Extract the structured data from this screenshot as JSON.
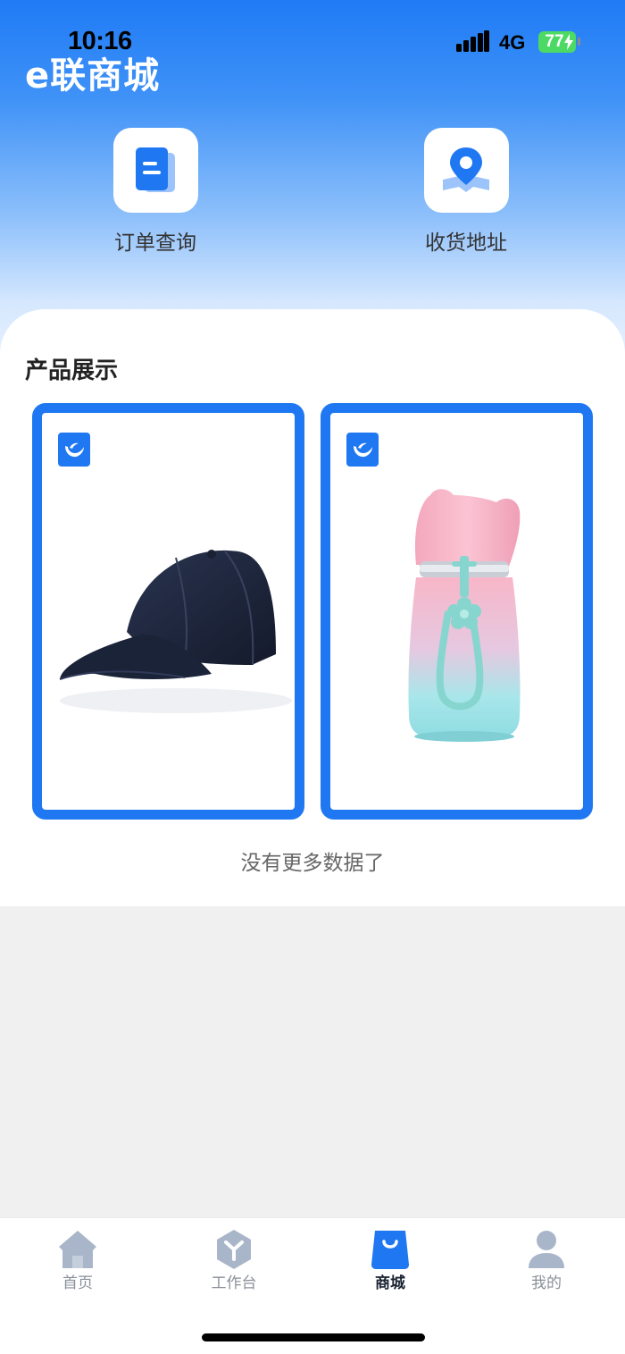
{
  "status_bar": {
    "time": "10:16",
    "network": "4G",
    "battery": "77"
  },
  "app": {
    "title": "e联商城"
  },
  "quick_entries": [
    {
      "label": "订单查询",
      "icon": "document-icon"
    },
    {
      "label": "收货地址",
      "icon": "location-pin-icon"
    }
  ],
  "products_section": {
    "title": "产品展示",
    "items": [
      {
        "image": "navy-baseball-cap",
        "badge": "brand-logo-icon"
      },
      {
        "image": "pink-blue-cat-ear-thermos-bottle",
        "badge": "brand-logo-icon"
      }
    ],
    "end_message": "没有更多数据了"
  },
  "tabbar": {
    "items": [
      {
        "label": "首页",
        "icon": "home-icon",
        "active": false
      },
      {
        "label": "工作台",
        "icon": "workbench-icon",
        "active": false
      },
      {
        "label": "商城",
        "icon": "shopping-bag-icon",
        "active": true
      },
      {
        "label": "我的",
        "icon": "user-icon",
        "active": false
      }
    ]
  },
  "colors": {
    "primary": "#1f78f2",
    "header_top": "#1f7bf5",
    "tab_inactive": "#8a8f99",
    "tab_active": "#1a2332"
  }
}
